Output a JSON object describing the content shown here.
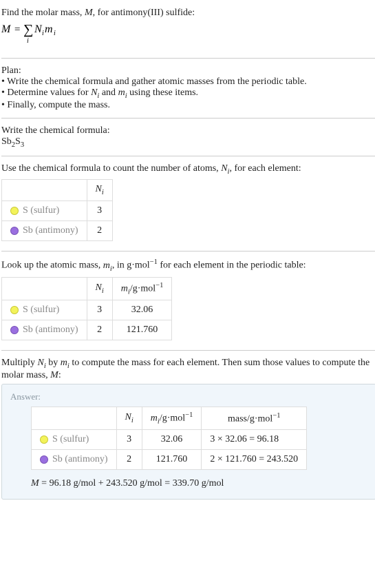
{
  "intro": {
    "line1_pre": "Find the molar mass, ",
    "line1_M": "M",
    "line1_post": ", for antimony(III) sulfide:"
  },
  "plan": {
    "title": "Plan:",
    "b1": "• Write the chemical formula and gather atomic masses from the periodic table.",
    "b2_pre": "• Determine values for ",
    "b2_mid": " and ",
    "b2_post": " using these items.",
    "b3": "• Finally, compute the mass."
  },
  "write": {
    "title": "Write the chemical formula:",
    "sb": "Sb",
    "sb_n": "2",
    "s": "S",
    "s_n": "3"
  },
  "count": {
    "pre": "Use the chemical formula to count the number of atoms, ",
    "post": ", for each element:"
  },
  "elements": {
    "s_label": "S (sulfur)",
    "sb_label": "Sb (antimony)"
  },
  "table1": {
    "s_N": "3",
    "sb_N": "2"
  },
  "lookup": {
    "pre": "Look up the atomic mass, ",
    "mid": ", in g·mol",
    "exp": "−1",
    "post": " for each element in the periodic table:"
  },
  "table2": {
    "s_N": "3",
    "s_m": "32.06",
    "sb_N": "2",
    "sb_m": "121.760"
  },
  "multiply": {
    "pre": "Multiply ",
    "mid1": " by ",
    "mid2": " to compute the mass for each element. Then sum those values to compute the molar mass, ",
    "M": "M",
    "post": ":"
  },
  "answer": {
    "label": "Answer:",
    "mass_hdr_pre": "mass/g·mol",
    "s_N": "3",
    "s_m": "32.06",
    "s_mass": "3 × 32.06 = 96.18",
    "sb_N": "2",
    "sb_m": "121.760",
    "sb_mass": "2 × 121.760 = 243.520",
    "final_pre": "M",
    "final_eq": " = 96.18 g/mol + 243.520 g/mol = 339.70 g/mol"
  },
  "sym": {
    "N": "N",
    "i": "i",
    "m": "m",
    "mi_hdr_pre": "/g·mol",
    "neg1": "−1"
  }
}
